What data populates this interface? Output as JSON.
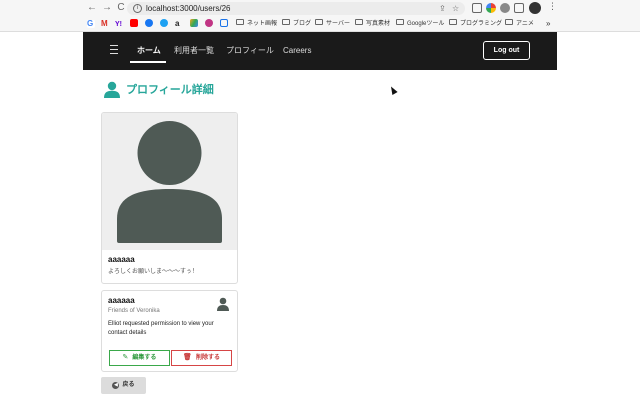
{
  "browser": {
    "url": "localhost:3000/users/26",
    "back_icon": "←",
    "forward_icon": "→",
    "reload_icon": "C",
    "more_bookmarks": "»",
    "bookmarks": [
      {
        "label": "G",
        "color": "#4285f4"
      },
      {
        "label": "M",
        "color": "#d93025"
      },
      {
        "label": "Y!",
        "color": "#6001d2"
      },
      {
        "label": "",
        "color": "#ff0000"
      },
      {
        "label": "",
        "color": "#1877f2"
      },
      {
        "label": "",
        "color": "#1da1f2"
      },
      {
        "label": "a",
        "color": "#222222"
      },
      {
        "label": "",
        "color": "#f5a623"
      },
      {
        "label": "",
        "color": "#c13584"
      },
      {
        "label": "",
        "color": "#1a73e8"
      }
    ],
    "folders": [
      "ネット画報",
      "ブログ",
      "サーバー",
      "写真素材",
      "Googleツール",
      "プログラミング",
      "アニメ"
    ]
  },
  "navbar": {
    "items": [
      "ホーム",
      "利用者一覧",
      "プロフィール",
      "Careers"
    ],
    "logout_label": "Log out"
  },
  "page": {
    "title": "プロフィール詳細"
  },
  "profile": {
    "name": "aaaaaa",
    "bio": "よろしくお願いしま〜〜〜すぅ！"
  },
  "request": {
    "name": "aaaaaa",
    "subtitle": "Friends of Veronika",
    "message": "Elliot requested permission to view your contact details",
    "edit_label": "編集する",
    "delete_label": "削除する"
  },
  "back": {
    "label": "戻る"
  },
  "colors": {
    "accent": "#27a69a",
    "avatar": "#4f5a55",
    "edit": "#3aa84a",
    "delete": "#d64545"
  }
}
